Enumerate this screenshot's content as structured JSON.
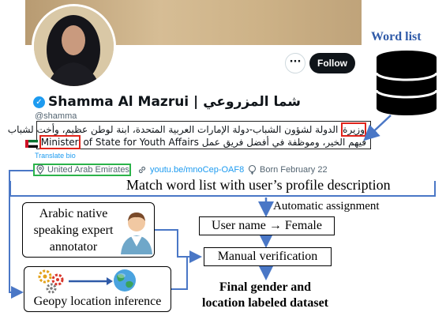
{
  "profile": {
    "more_label": "···",
    "follow_label": "Follow",
    "display_name": "Shamma Al Mazrui | شما المزروعي",
    "handle": "@shamma",
    "bio_line1_pre": "",
    "bio_highlight_ar": "وزيرة",
    "bio_line1_rest": " الدولة لشؤون الشباب-دولة الإمارات العربية المتحدة، ابنة لوطن عظيم، وأخت لشباب",
    "bio_highlight_en": "Minister",
    "bio_line2_rest": " of State for Youth Affairs",
    "bio_line2_ar": "فيهم الخير، وموظفة في أفضل فريق عمل",
    "translate_label": "Translate bio",
    "location": "United Arab Emirates",
    "link": "youtu.be/mnoCep-OAF8",
    "born": "Born February 22"
  },
  "diagram": {
    "word_list_title": "Word list",
    "match_label": "Match word list with user’s profile description",
    "auto_assign_label": "Automatic assignment",
    "user_name_box": "User name → Female",
    "manual_verification_box": "Manual verification",
    "expert_box": "Arabic native speaking expert annotator",
    "geopy_box": "Geopy location inference",
    "final_label": "Final gender and location labeled dataset"
  },
  "colors": {
    "accent_blue": "#4a77c6",
    "highlight_red": "#e0241b",
    "highlight_green": "#2bb34a",
    "twitter_blue": "#1d9bf0",
    "word_list_title": "#2f5aa8"
  }
}
